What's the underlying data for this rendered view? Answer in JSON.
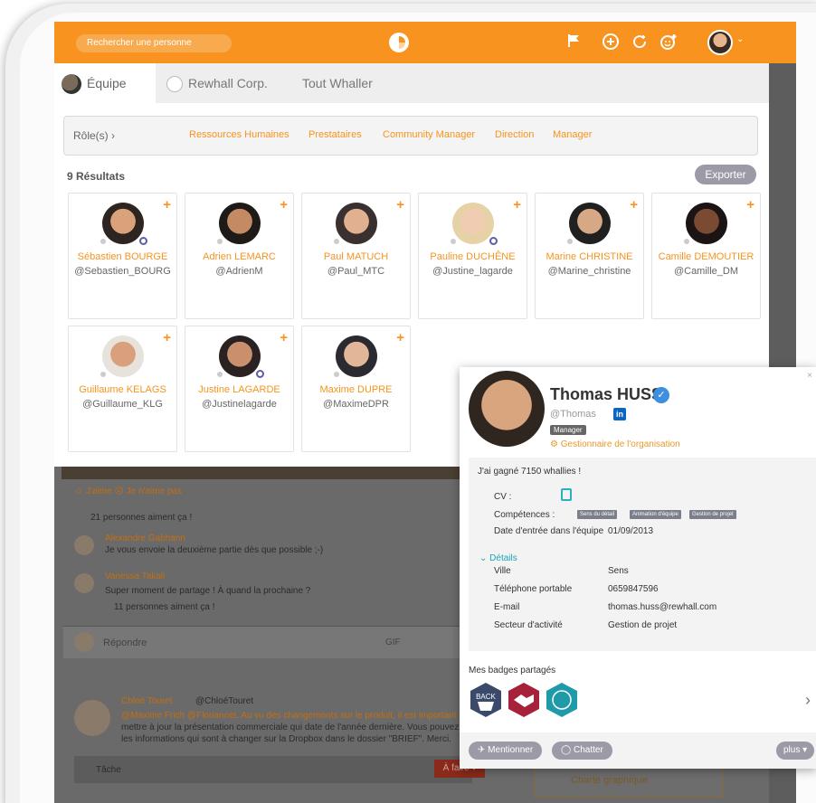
{
  "topbar": {
    "search_placeholder": "Rechercher une personne",
    "icons": [
      "flag-icon",
      "add-tray-icon",
      "add-refresh-icon",
      "add-smiley-icon"
    ],
    "caret": "⌄"
  },
  "tabs": [
    {
      "label": "Équipe",
      "active": true
    },
    {
      "label": "Rewhall Corp.",
      "active": false
    },
    {
      "label": "Tout Whaller",
      "active": false
    }
  ],
  "roles": {
    "label": "Rôle(s) ›",
    "items": [
      "Ressources Humaines",
      "Prestataires",
      "Community Manager",
      "Direction",
      "Manager"
    ]
  },
  "results": {
    "label": "9 Résultats",
    "export": "Exporter"
  },
  "people": [
    {
      "name": "Sébastien BOURGE",
      "handle": "@Sebastien_BOURG"
    },
    {
      "name": "Adrien LEMARC",
      "handle": "@AdrienM"
    },
    {
      "name": "Paul MATUCH",
      "handle": "@Paul_MTC"
    },
    {
      "name": "Pauline DUCHÊNE",
      "handle": "@Justine_lagarde"
    },
    {
      "name": "Marine CHRISTINE",
      "handle": "@Marine_christine"
    },
    {
      "name": "Camille DEMOUTIER",
      "handle": "@Camille_DM"
    },
    {
      "name": "Guillaume KELAGS",
      "handle": "@Guillaume_KLG"
    },
    {
      "name": "Justine LAGARDE",
      "handle": "@Justinelagarde"
    },
    {
      "name": "Maxime DUPRE",
      "handle": "@MaximeDPR"
    }
  ],
  "feed": {
    "likes_bar": "☺ J'aime  ☹ Je n'aime pas",
    "likes_count": "21 personnes aiment ça !",
    "c1_name": "Alexandre Gabhann",
    "c1_text": "Je vous envoie la deuxième partie dès que possible ;-)",
    "c2_name": "Vanessa Takali",
    "c2_text": "Super moment de partage ! À quand la prochaine ?",
    "c2_likes": "11 personnes aiment ça !",
    "reply": "Répondre",
    "gif": "GIF",
    "post_name": "Chloé Touret",
    "post_handle": "@ChloéTouret",
    "post_text_1": "@Maxime Frich @FlorianneL  Au vu des changements sur le produit, il est important",
    "post_text_2": "mettre à jour la présentation commerciale qui date de l'année dernière. Vous pouvez",
    "post_text_3": "les informations qui sont à changer sur la Dropbox dans le dossier \"BRIEF\". Merci.",
    "task": "Tâche",
    "todo": "À faire ▾",
    "charte": "Charte graphique"
  },
  "profile": {
    "name": "Thomas HUSS",
    "handle": "@Thomas",
    "linkedin": "in",
    "role": "Manager",
    "org": "Gestionnaire de l'organisation",
    "close": "×",
    "achievement": "J'ai gagné 7150 whallies !",
    "cv_label": "CV :",
    "skills_label": "Compétences :",
    "skills": [
      "Sens du détail",
      "Animation d'équipe",
      "Gestion de projet"
    ],
    "entry_label": "Date d'entrée dans l'équipe",
    "entry_date": "01/09/2013",
    "details_label": "Détails",
    "details": [
      {
        "label": "Ville",
        "value": "Sens"
      },
      {
        "label": "Téléphone portable",
        "value": "0659847596"
      },
      {
        "label": "E-mail",
        "value": "thomas.huss@rewhall.com"
      },
      {
        "label": "Secteur d'activité",
        "value": "Gestion de projet"
      }
    ],
    "badges_title": "Mes badges partagés",
    "badges": [
      "back-badge",
      "handshake-badge",
      "performance-badge"
    ],
    "mention": "Mentionner",
    "chat": "Chatter",
    "more": "plus ▾"
  },
  "colors": {
    "accent": "#f7931e",
    "teal": "#1aa3b8",
    "button_gray": "#9b9aa6"
  }
}
